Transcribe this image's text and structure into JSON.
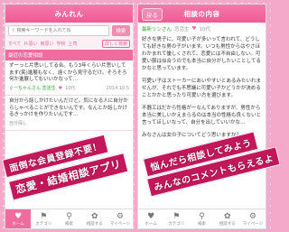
{
  "left": {
    "title": "みんれん",
    "search": {
      "placeholder": "検索キーワードを入れてね",
      "button": "検索"
    },
    "categories": [
      "すべて",
      "片思い",
      "両思い",
      "学校",
      "上司"
    ],
    "categories_detail": "詳しく検索",
    "section": "最近の恋愛相談",
    "posts": [
      {
        "text": "ずーっと片思いしてる合。もう3年くらい片思いしてます(笑)進展もなく、遠くから見守るだけ。そろそろ何か進展してもいいかなって…",
        "user": "たかはし",
        "meta": "ぐーちゃんさん 恋活生",
        "count": "10代",
        "date": "2014.10.5"
      },
      {
        "text": "自分から話しかけたいんだけど。気になる人に自分からしゃべることができないんです。なんとか話しかけるきっかけを作りたいんです…",
        "user": "",
        "meta": "自分探し",
        "count": "",
        "date": ""
      }
    ]
  },
  "right": {
    "back": "戻る",
    "title": "相談の内容",
    "author": "最新リンさん",
    "author_meta": "恋活生",
    "author_age": "10代",
    "paragraphs": [
      "好きな男子に、可愛い子が多いって言われて、どうしても好きな男の子がいます。いつも男性からはやさほわかまれて優しくされて、恋愛には不自由しない。可愛い服は似合うのでも本当に自分がしたいことしてるかなと思っています。",
      "可愛い子はストーカーにあいやすいとあるみたいれませんが、それでも不思議に可愛い子かどうかが決めることかかと思ったり可愛い方を選びます。",
      "不器工はだから性格がーなんてありますが、男性から本当に美しいかえまらるのは本当の性格も良くないと言ってほしいなって、自分を出していいかな…",
      "みなさんは女の子についてどう思いますか？"
    ]
  },
  "tabs": [
    {
      "icon": "heart",
      "label": "ホーム"
    },
    {
      "icon": "tag",
      "label": "カテゴリ"
    },
    {
      "icon": "search",
      "label": "検索"
    },
    {
      "icon": "ribbon",
      "label": "相談する"
    },
    {
      "icon": "gear",
      "label": "マイページ"
    }
  ],
  "banners": {
    "left_1": "面倒な会員登録不要！",
    "left_2": "恋愛・結婚相談アプリ",
    "right_1": "悩んだら相談してみよう",
    "right_2": "みんなのコメントもらえるよ"
  },
  "colors": {
    "accent": "#f06b9e",
    "user": "#2aa52a",
    "background": "#f5a9c9"
  }
}
